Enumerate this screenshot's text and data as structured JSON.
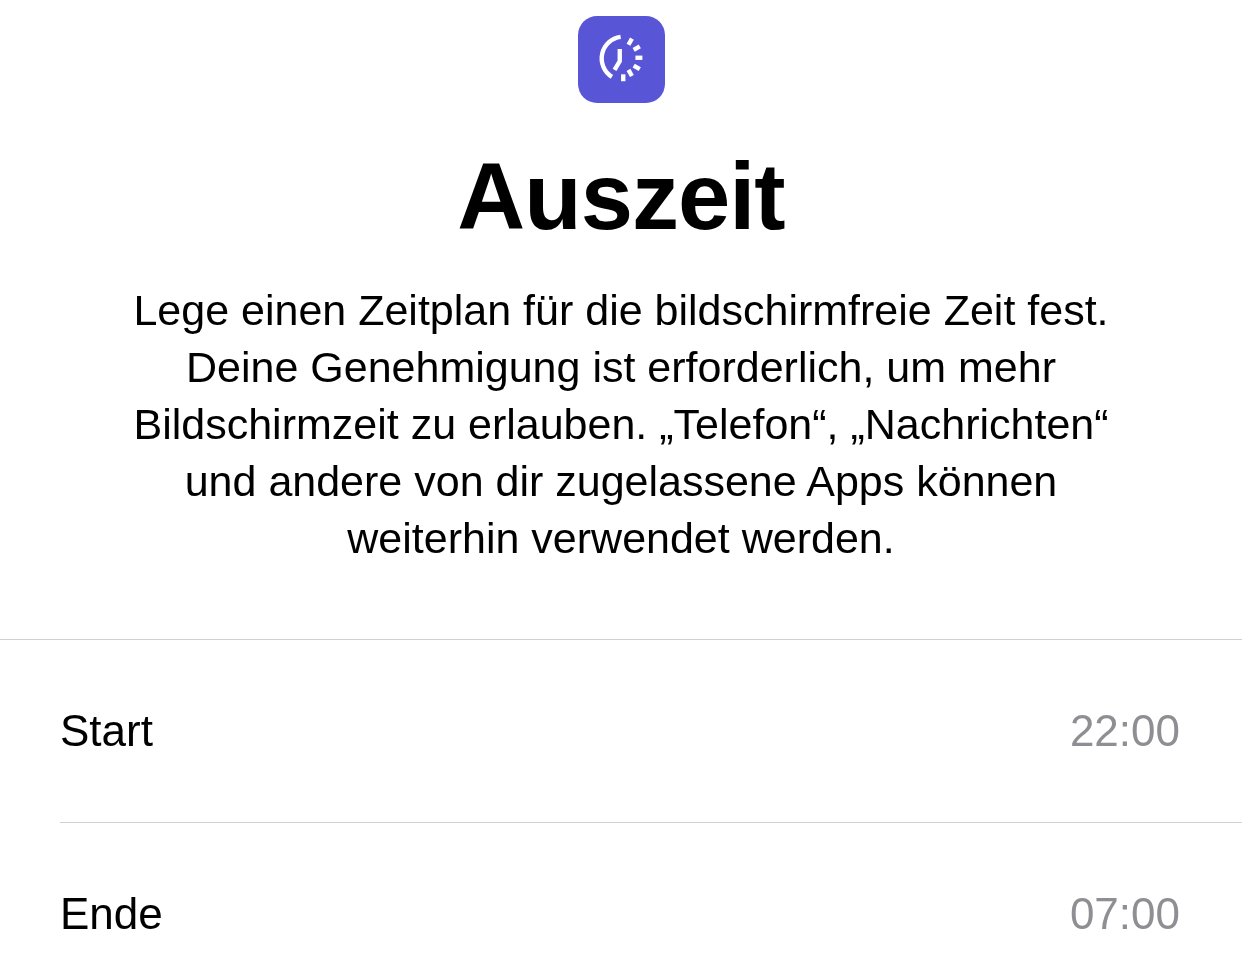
{
  "title": "Auszeit",
  "description": "Lege einen Zeitplan für die bildschirmfreie Zeit fest. Deine Genehmigung ist erforderlich, um mehr Bildschirmzeit zu erlauben. „Telefon“, „Nachrichten“ und andere von dir zugelassene Apps können weiterhin verwendet werden.",
  "rows": [
    {
      "label": "Start",
      "value": "22:00"
    },
    {
      "label": "Ende",
      "value": "07:00"
    }
  ]
}
